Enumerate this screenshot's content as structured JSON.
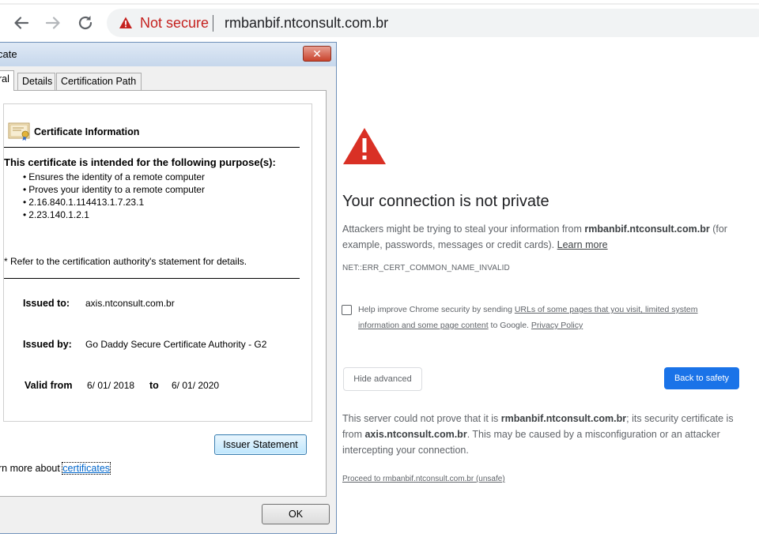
{
  "browser": {
    "security_label": "Not secure",
    "url": "rmbanbif.ntconsult.com.br",
    "icons": {
      "back": "back-arrow-icon",
      "forward": "forward-arrow-icon",
      "reload": "reload-icon",
      "security": "warning-triangle-icon"
    },
    "colors": {
      "not_secure": "#c5221f",
      "omnibox_bg": "#f1f3f4"
    }
  },
  "interstitial": {
    "heading": "Your connection is not private",
    "intro_prefix": "Attackers might be trying to steal your information from ",
    "intro_domain": "rmbanbif.ntconsult.com.br",
    "intro_suffix": " (for example, passwords, messages or credit cards). ",
    "learn_more": "Learn more",
    "error_code": "NET::ERR_CERT_COMMON_NAME_INVALID",
    "safebrowsing": {
      "checked": false,
      "prefix": "Help improve Chrome security by sending ",
      "link": "URLs of some pages that you visit, limited system information and some page content",
      "middle": " to Google. ",
      "privacy": "Privacy Policy"
    },
    "hide_advanced": "Hide advanced",
    "back_to_safety": "Back to safety",
    "detail_prefix": "This server could not prove that it is ",
    "detail_domain": "rmbanbif.ntconsult.com.br",
    "detail_mid": "; its security certificate is from ",
    "detail_issuer_domain": "axis.ntconsult.com.br",
    "detail_suffix": ". This may be caused by a misconfiguration or an attacker intercepting your connection.",
    "proceed": "Proceed to rmbanbif.ntconsult.com.br (unsafe)",
    "colors": {
      "accent": "#1a73e8",
      "warning": "#d93025"
    }
  },
  "cert_dialog": {
    "title": "cate",
    "close": "✕",
    "tabs": [
      {
        "label": "ral",
        "active": true
      },
      {
        "label": "Details",
        "active": false
      },
      {
        "label": "Certification Path",
        "active": false
      }
    ],
    "info_title": "Certificate Information",
    "purpose_title": "This certificate is intended for the following purpose(s):",
    "purposes": [
      "Ensures the identity of a remote computer",
      "Proves your identity to a remote computer",
      "2.16.840.1.114413.1.7.23.1",
      "2.23.140.1.2.1"
    ],
    "refer": "* Refer to the certification authority's statement for details.",
    "issued_to_label": "Issued to:",
    "issued_to": "axis.ntconsult.com.br",
    "issued_by_label": "Issued by:",
    "issued_by": "Go Daddy Secure Certificate Authority - G2",
    "valid_from_label": "Valid from",
    "valid_from": "6/ 01/ 2018",
    "to_label": "to",
    "valid_to": "6/ 01/ 2020",
    "issuer_statement": "Issuer Statement",
    "learn_prefix": "rn more about ",
    "learn_link": "certificates",
    "ok": "OK"
  }
}
